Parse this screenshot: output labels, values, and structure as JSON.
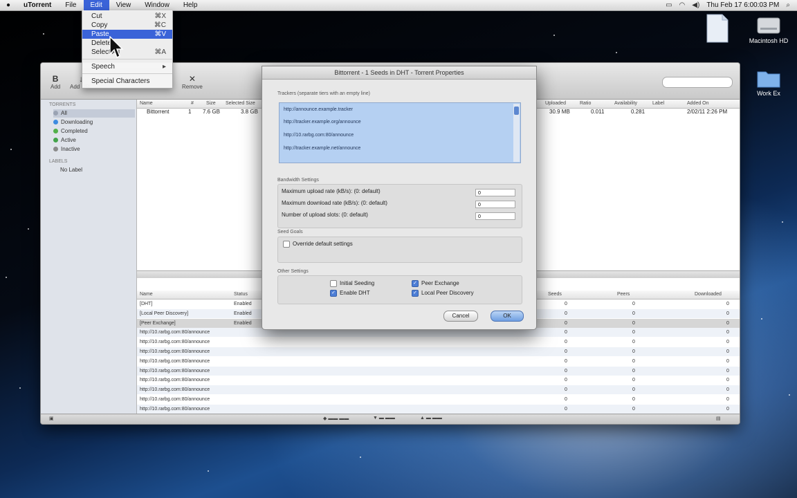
{
  "menubar": {
    "app_name": "uTorrent",
    "items": [
      "File",
      "Edit",
      "View",
      "Window",
      "Help"
    ],
    "active_index": 1,
    "clock": "Thu Feb 17  6:00:03 PM"
  },
  "edit_menu": {
    "items": [
      {
        "label": "Cut",
        "shortcut": "⌘X"
      },
      {
        "label": "Copy",
        "shortcut": "⌘C"
      },
      {
        "label": "Paste",
        "shortcut": "⌘V"
      },
      {
        "label": "Delete",
        "shortcut": ""
      },
      {
        "label": "Select All",
        "shortcut": "⌘A"
      },
      {
        "label": "Speech",
        "shortcut": "▸"
      },
      {
        "label": "Special Characters",
        "shortcut": ""
      }
    ],
    "highlighted_index": 2
  },
  "desktop_icons": [
    {
      "label": "Macintosh HD"
    },
    {
      "label": "Work Ex"
    }
  ],
  "window": {
    "toolbar": {
      "add": "Add",
      "add_url": "Add URL",
      "remove": "Remove"
    },
    "sidebar": {
      "torrents_header": "Torrents",
      "items": [
        {
          "label": "All",
          "color": "#9aa3b3"
        },
        {
          "label": "Downloading",
          "color": "#3d8be0"
        },
        {
          "label": "Completed",
          "color": "#52b04a"
        },
        {
          "label": "Active",
          "color": "#42a34a"
        },
        {
          "label": "Inactive",
          "color": "#8a8a8a"
        }
      ],
      "labels_header": "Labels",
      "no_label": "No Label"
    },
    "torrent_table": {
      "headers": [
        "Name",
        "#",
        "Size",
        "Selected Size",
        "Uploaded",
        "Ratio",
        "Availability",
        "Label",
        "Added On"
      ],
      "rows": [
        {
          "name": "Bittorrent",
          "num": "1",
          "size": "7.6 GB",
          "selected": "3.8 GB",
          "uploaded": "30.9 MB",
          "ratio": "0.011",
          "availability": "0.281",
          "label": "",
          "added": "2/02/11 2:26 PM"
        }
      ]
    },
    "trackers_table": {
      "headers": [
        "Name",
        "Status",
        "Seeds",
        "Peers",
        "Downloaded"
      ],
      "rows": [
        {
          "name": "[DHT]",
          "status": "Enabled",
          "seeds": "0",
          "peers": "0",
          "dl": "0"
        },
        {
          "name": "[Local Peer Discovery]",
          "status": "Enabled",
          "seeds": "0",
          "peers": "0",
          "dl": "0"
        },
        {
          "name": "[Peer Exchange]",
          "status": "Enabled",
          "seeds": "0",
          "peers": "0",
          "dl": "0"
        },
        {
          "name": "http://10.rarbg.com:80/announce",
          "status": "",
          "seeds": "0",
          "peers": "0",
          "dl": "0"
        },
        {
          "name": "http://10.rarbg.com:80/announce",
          "status": "",
          "seeds": "0",
          "peers": "0",
          "dl": "0"
        },
        {
          "name": "http://10.rarbg.com:80/announce",
          "status": "",
          "seeds": "0",
          "peers": "0",
          "dl": "0"
        },
        {
          "name": "http://10.rarbg.com:80/announce",
          "status": "",
          "seeds": "0",
          "peers": "0",
          "dl": "0"
        },
        {
          "name": "http://10.rarbg.com:80/announce",
          "status": "",
          "seeds": "0",
          "peers": "0",
          "dl": "0"
        },
        {
          "name": "http://10.rarbg.com:80/announce",
          "status": "",
          "seeds": "0",
          "peers": "0",
          "dl": "0"
        },
        {
          "name": "http://10.rarbg.com:80/announce",
          "status": "",
          "seeds": "0",
          "peers": "0",
          "dl": "0"
        },
        {
          "name": "http://10.rarbg.com:80/announce",
          "status": "",
          "seeds": "0",
          "peers": "0",
          "dl": "0"
        },
        {
          "name": "http://10.rarbg.com:80/announce",
          "status": "",
          "seeds": "0",
          "peers": "0",
          "dl": "0"
        }
      ]
    }
  },
  "dialog": {
    "title": "Bittorrent - 1 Seeds in DHT - Torrent Properties",
    "trackers_label": "Trackers (separate tiers with an empty line)",
    "trackers": [
      "http://announce.example.tracker",
      "http://tracker.example.org/announce",
      "http://10.rarbg.com:80/announce",
      "http://tracker.example.net/announce"
    ],
    "bandwidth_label": "Bandwidth Settings",
    "max_upload_label": "Maximum upload rate (kB/s): (0: default)",
    "max_upload_value": "0",
    "max_download_label": "Maximum download rate (kB/s): (0: default)",
    "max_download_value": "0",
    "upload_slots_label": "Number of upload slots: (0: default)",
    "upload_slots_value": "0",
    "seed_goals_label": "Seed Goals",
    "override_label": "Override default settings",
    "other_label": "Other Settings",
    "initial_seeding": "Initial Seeding",
    "enable_dht": "Enable DHT",
    "peer_exchange": "Peer Exchange",
    "local_peer": "Local Peer Discovery",
    "cancel": "Cancel",
    "ok": "OK"
  }
}
